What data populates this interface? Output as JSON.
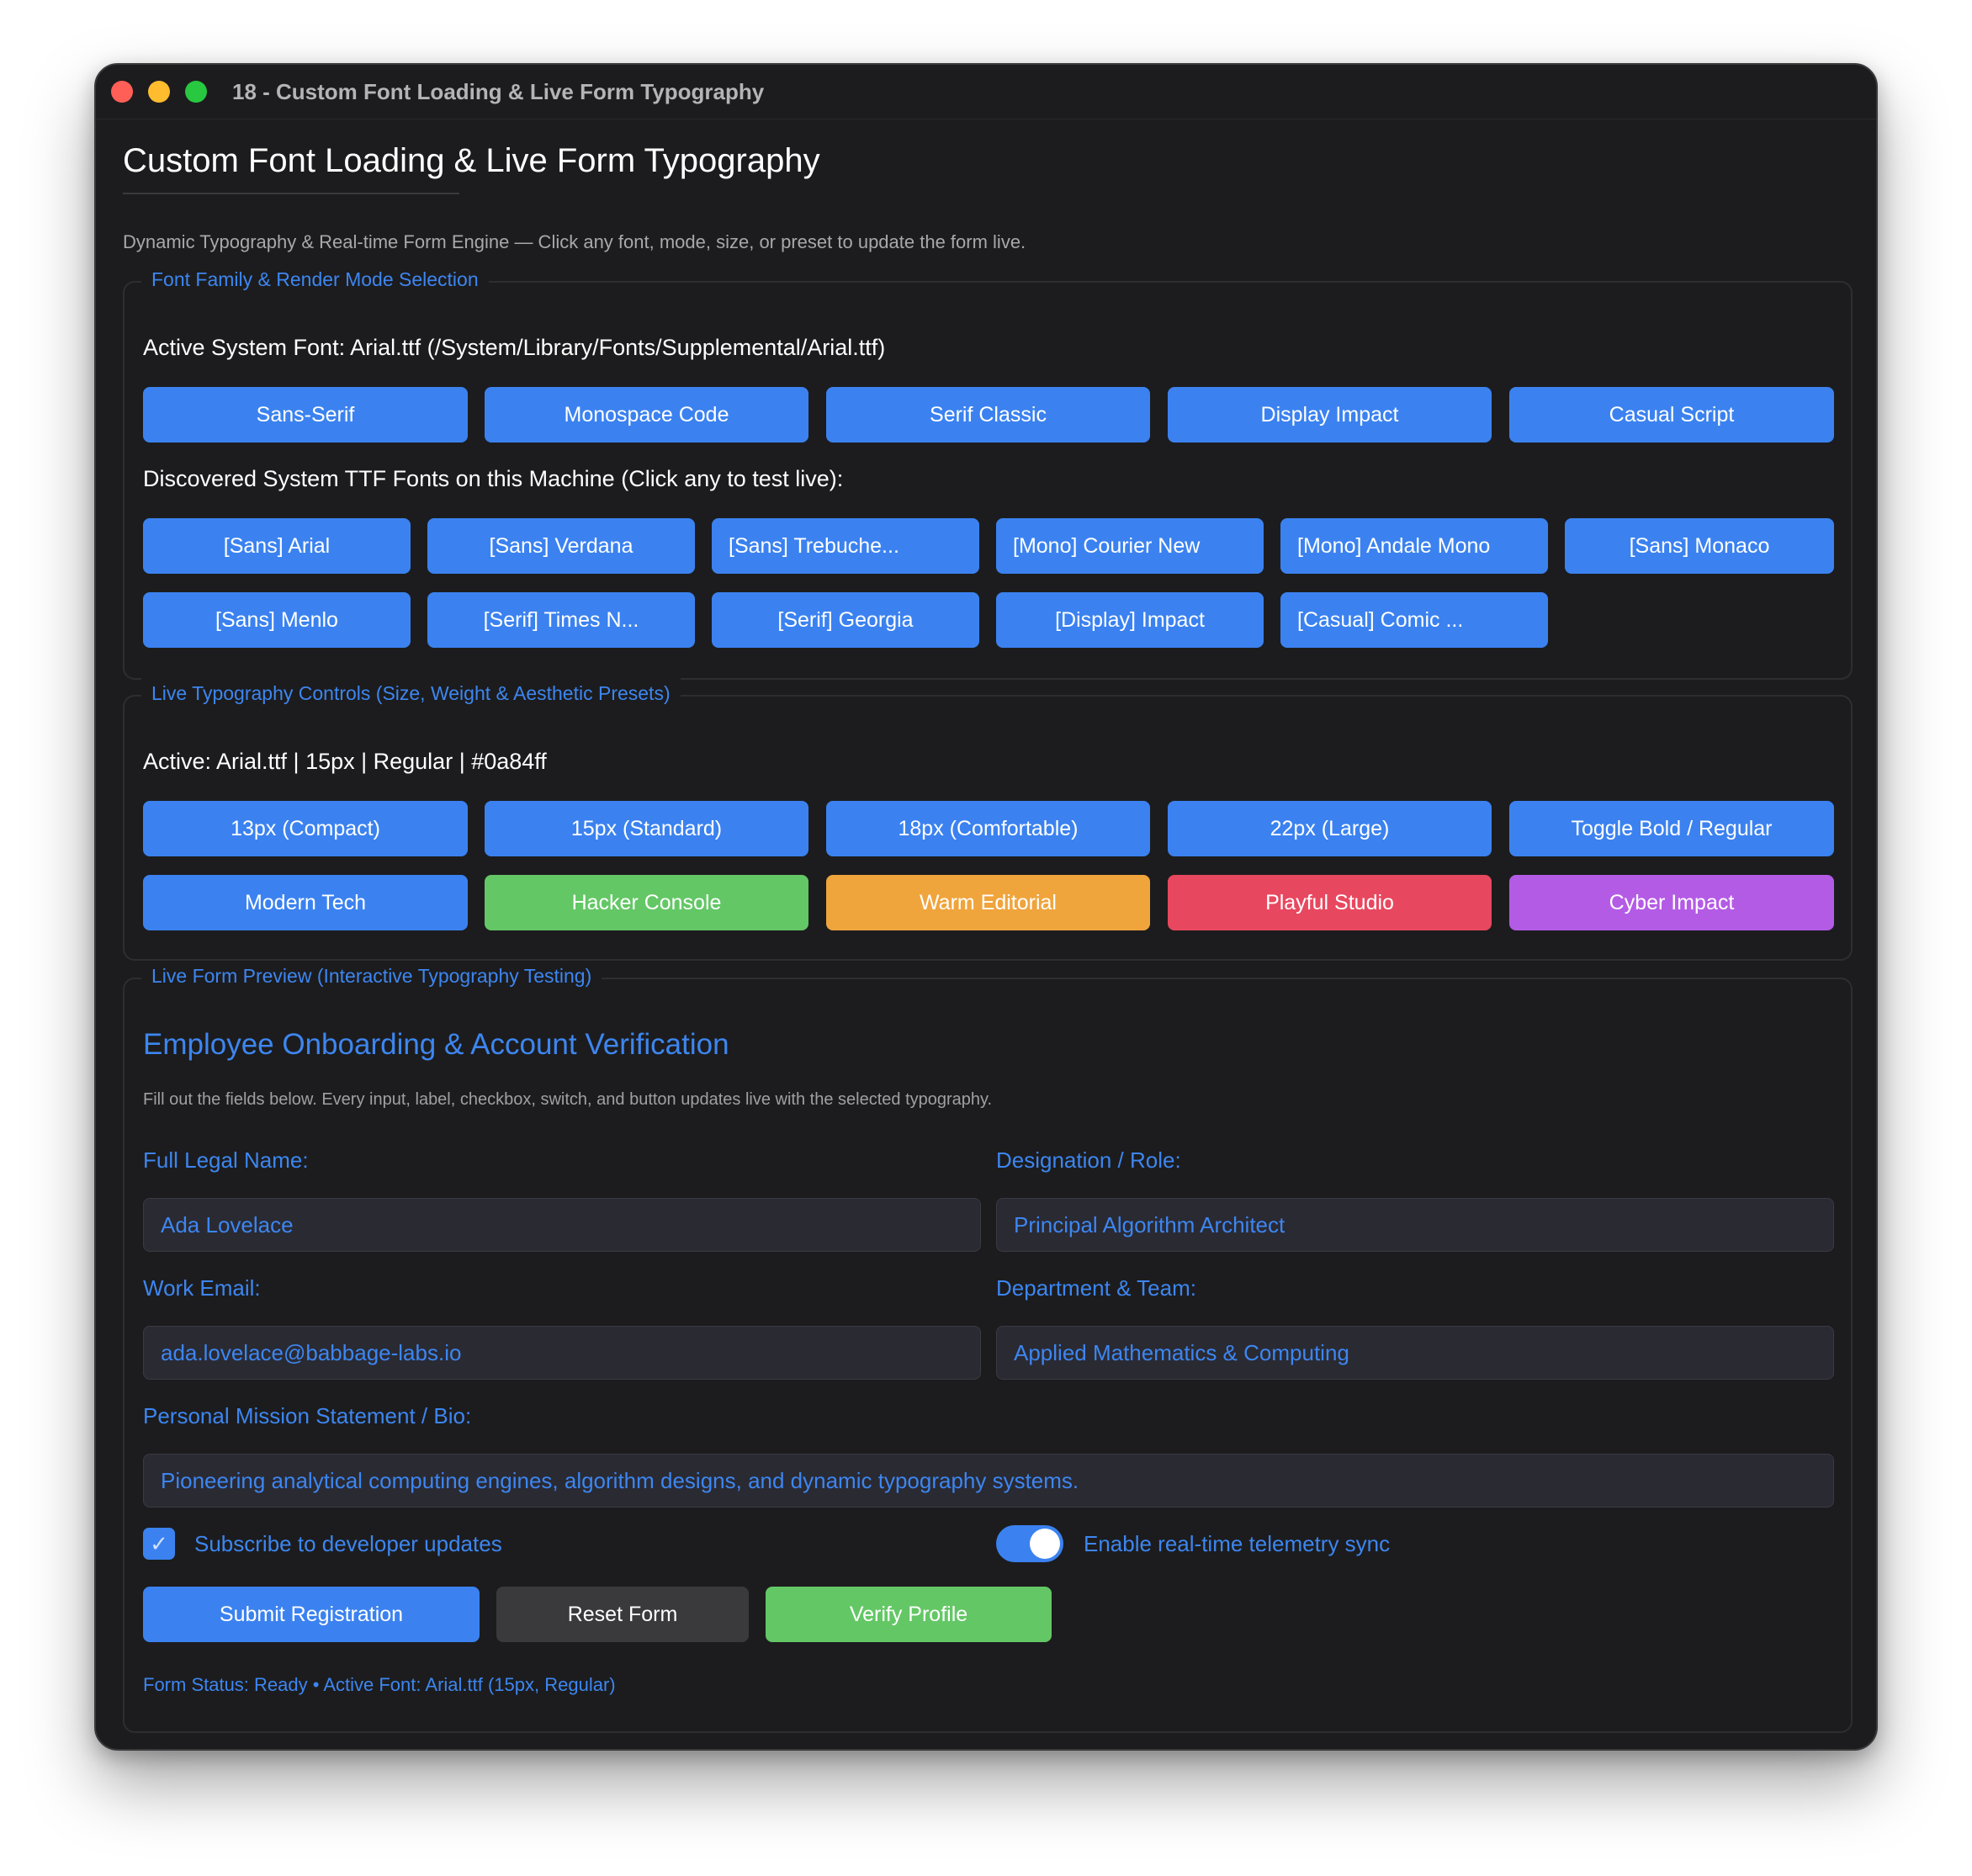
{
  "window": {
    "title": "18 - Custom Font Loading & Live Form Typography"
  },
  "header": {
    "title": "Custom Font Loading & Live Form Typography",
    "subtitle": "Dynamic Typography & Real-time Form Engine — Click any font, mode, size, or preset to update the form live."
  },
  "font_section": {
    "legend": "Font Family & Render Mode Selection",
    "active_font": "Active System Font: Arial.ttf (/System/Library/Fonts/Supplemental/Arial.ttf)",
    "modes": [
      "Sans-Serif",
      "Monospace Code",
      "Serif Classic",
      "Display Impact",
      "Casual Script"
    ],
    "discovered_label": "Discovered System TTF Fonts on this Machine (Click any to test live):",
    "fonts": [
      "[Sans] Arial",
      "[Sans] Verdana",
      "[Sans] Trebuche...",
      "[Mono] Courier New",
      "[Mono] Andale Mono",
      "[Sans] Monaco",
      "[Sans] Menlo",
      "[Serif] Times N...",
      "[Serif] Georgia",
      "[Display] Impact",
      "[Casual] Comic ..."
    ]
  },
  "typography_section": {
    "legend": "Live Typography Controls (Size, Weight & Aesthetic Presets)",
    "active": "Active: Arial.ttf | 15px | Regular | #0a84ff",
    "sizes": [
      "13px (Compact)",
      "15px (Standard)",
      "18px (Comfortable)",
      "22px (Large)",
      "Toggle Bold / Regular"
    ],
    "presets": [
      "Modern Tech",
      "Hacker Console",
      "Warm Editorial",
      "Playful Studio",
      "Cyber Impact"
    ]
  },
  "form_section": {
    "legend": "Live Form Preview (Interactive Typography Testing)",
    "title": "Employee Onboarding & Account Verification",
    "description": "Fill out the fields below. Every input, label, checkbox, switch, and button updates live with the selected typography.",
    "fields": {
      "name_label": "Full Legal Name:",
      "name_value": "Ada Lovelace",
      "role_label": "Designation / Role:",
      "role_value": "Principal Algorithm Architect",
      "email_label": "Work Email:",
      "email_value": "ada.lovelace@babbage-labs.io",
      "dept_label": "Department & Team:",
      "dept_value": "Applied Mathematics & Computing",
      "bio_label": "Personal Mission Statement / Bio:",
      "bio_value": "Pioneering analytical computing engines, algorithm designs, and dynamic typography systems."
    },
    "subscribe_label": "Subscribe to developer updates",
    "subscribe_checked": true,
    "telemetry_label": "Enable real-time telemetry sync",
    "telemetry_on": true,
    "buttons": {
      "submit": "Submit Registration",
      "reset": "Reset Form",
      "verify": "Verify Profile"
    },
    "status": "Form Status: Ready • Active Font: Arial.ttf (15px, Regular)"
  },
  "colors": {
    "accent": "#3b82f0",
    "green": "#63c765",
    "orange": "#f0a43c",
    "red": "#e8485f",
    "purple": "#b45be6",
    "window_bg": "#1c1c1e"
  },
  "icons": {
    "checkbox_check": "checkmark-icon"
  }
}
